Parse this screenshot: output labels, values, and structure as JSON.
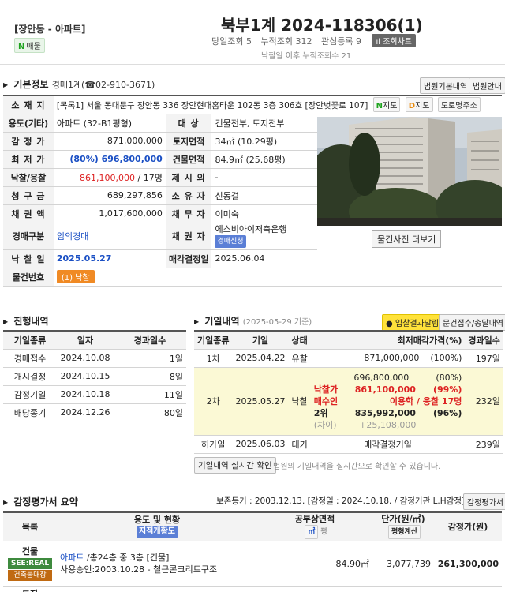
{
  "header": {
    "location": "[장안동 - 아파트]",
    "maemul_n": "N",
    "maemul_label": "매물",
    "case_title": "북부1계 2024-118306(1)",
    "today_views": "당일조회 5",
    "total_views": "누적조회 312",
    "interest": "관심등록 9",
    "chart_btn": "조회차트",
    "after_bid": "낙찰일 이후 누적조회수 21"
  },
  "basic": {
    "heading": "기본정보",
    "court": "경매1계(☎02-910-3671)",
    "btn_court_notice": "법원기본내역",
    "btn_court_info": "법원안내",
    "labels": {
      "address": "소 재 지",
      "use": "용도(기타)",
      "target": "대 상",
      "appraisal": "감 정 가",
      "land_area": "토지면적",
      "min_price": "최 저 가",
      "bldg_area": "건물면적",
      "bid": "낙찰/응찰",
      "exclude": "제 시 외",
      "claim": "청 구 금",
      "owner": "소 유 자",
      "bond": "채 권 액",
      "debtor": "채 무 자",
      "auction_type": "경매구분",
      "creditor": "채 권 자",
      "bid_date": "낙 찰 일",
      "decision_date": "매각결정일",
      "item_no": "물건번호"
    },
    "address": "[목록1] 서울 동대문구 장안동 336 장안현대홈타운 102동 3층 306호 [장안벚꽃로 107]",
    "nmap_n": "N",
    "nmap_label": "지도",
    "dmap_d": "D",
    "dmap_label": "지도",
    "road_addr": "도로명주소",
    "use": "아파트 (32-B1평형)",
    "target": "건물전부, 토지전부",
    "appraisal": "871,000,000",
    "land_area": "34㎡ (10.29평)",
    "min_price": "(80%) 696,800,000",
    "bldg_area": "84.9㎡ (25.68평)",
    "bid_price": "861,100,000",
    "bid_count": " / 17명",
    "exclude": "-",
    "claim": "689,297,856",
    "owner": "신동걸",
    "bond": "1,017,600,000",
    "debtor": "이미숙",
    "auction_type": "임의경매",
    "creditor": "에스비아이저축은행",
    "creditor_badge": "경매신청",
    "bid_date": "2025.05.27",
    "decision_date": "2025.06.04",
    "item_badge": "(1) 낙찰",
    "photo_btn": "물건사진 더보기"
  },
  "progress": {
    "heading": "진행내역",
    "cols": [
      "기일종류",
      "일자",
      "경과일수"
    ],
    "rows": [
      [
        "경매접수",
        "2024.10.08",
        "1일"
      ],
      [
        "개시결정",
        "2024.10.15",
        "8일"
      ],
      [
        "감정기일",
        "2024.10.18",
        "11일"
      ],
      [
        "배당종기",
        "2024.12.26",
        "80일"
      ]
    ]
  },
  "auction": {
    "heading": "기일내역",
    "date_note": "(2025-05-29 기준)",
    "btn_result": "입찰결과알림",
    "btn_docs": "문건접수/송달내역",
    "cols": [
      "기일종류",
      "기일",
      "상태",
      "최저매각가격(%)",
      "경과일수"
    ],
    "row1": {
      "round": "1차",
      "date": "2025.04.22",
      "status": "유찰",
      "price": "871,000,000",
      "pct": "(100%)",
      "days": "197일"
    },
    "row2": {
      "round": "2차",
      "date": "2025.05.27",
      "status": "낙찰",
      "min_price": "696,800,000",
      "min_pct": "(80%)",
      "bid_label": "낙찰가",
      "bid_price": "861,100,000",
      "bid_pct": "(99%)",
      "buyer_label": "매수인",
      "buyer": "이용학 / 응찰 17명",
      "second_label": "2위",
      "second_price": "835,992,000",
      "second_pct": "(96%)",
      "diff_label": "(차이)",
      "diff": "+25,108,000",
      "days": "232일"
    },
    "row3": {
      "round": "허가일",
      "date": "2025.06.03",
      "status": "대기",
      "note": "매각결정기일",
      "days": "239일"
    },
    "realtime_btn": "기일내역 실시간 확인",
    "realtime_note": "법원의 기일내역을 실시간으로 확인할 수 있습니다."
  },
  "appraisal": {
    "heading": "감정평가서 요약",
    "meta": "보존등기 : 2003.12.13. [감정일 : 2024.10.18. / 감정기관 L.H감정]",
    "btn": "감정평가서",
    "cols": [
      "목록",
      "용도 및 현황",
      "공부상면적",
      "단가(원/㎡)",
      "감정가(원)"
    ],
    "sub_badge": "지적개황도",
    "area_toggle_a": "㎡",
    "area_toggle_b": "평",
    "unit_calc": "평형계산",
    "row_label": "건물",
    "row_badge1": "SEE:REAL",
    "row_badge2": "건축물대장",
    "row_use_link": "아파트",
    "row_use_rest": " /총24층 중 3층 [건물]",
    "row_use_line2": "사용승인:2003.10.28 - 철근콘크리트구조",
    "row_area": "84.90㎡",
    "row_unit": "3,077,739",
    "row_value": "261,300,000",
    "next_label": "토지"
  }
}
